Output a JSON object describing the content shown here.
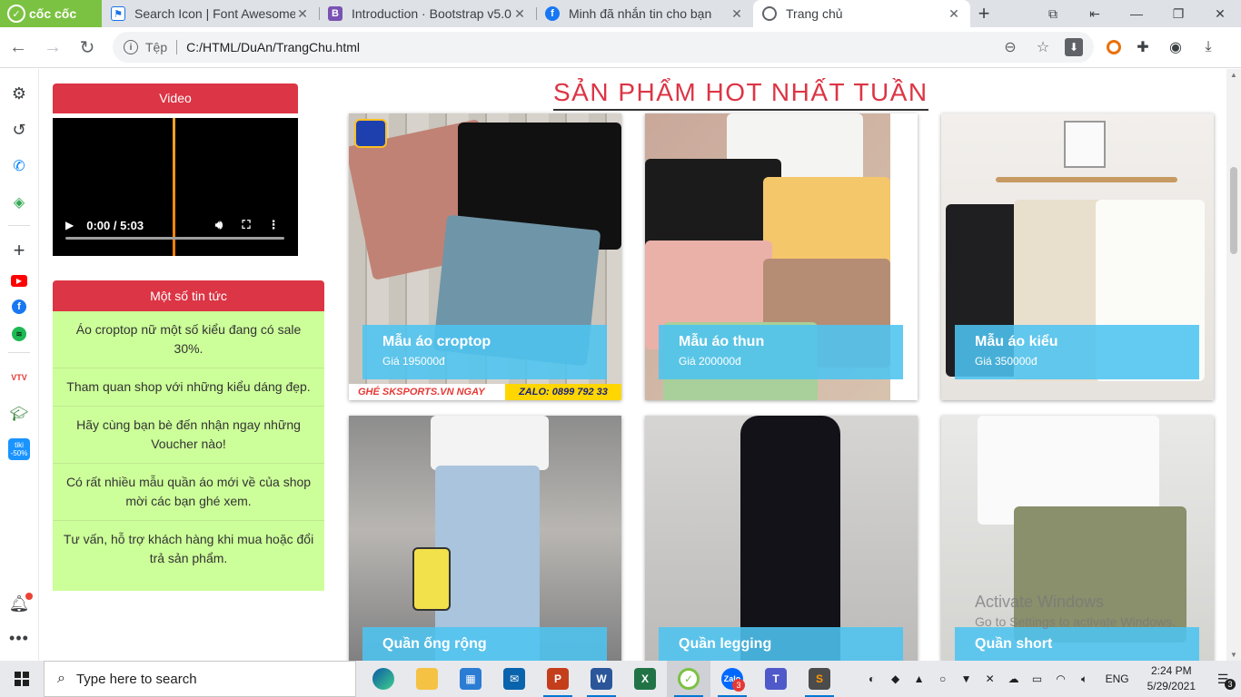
{
  "browser": {
    "logo_text": "cốc cốc",
    "tabs": [
      {
        "title": "Search Icon | Font Awesome",
        "favicon": "flag-icon",
        "active": false
      },
      {
        "title": "Introduction · Bootstrap v5.0",
        "favicon": "bootstrap-icon",
        "active": false
      },
      {
        "title": "Minh đã nhắn tin cho bạn",
        "favicon": "facebook-icon",
        "active": false
      },
      {
        "title": "Trang chủ",
        "favicon": "globe-icon",
        "active": true
      }
    ],
    "address": {
      "scheme_label": "Tệp",
      "url": "C:/HTML/DuAn/TrangChu.html"
    }
  },
  "page": {
    "video_header": "Video",
    "video_time": "0:00 / 5:03",
    "news_header": "Một số tin tức",
    "news": [
      "Áo croptop nữ một số kiểu đang có sale 30%.",
      "Tham quan shop với những kiểu dáng đẹp.",
      "Hãy cùng bạn bè đến nhận ngay những Voucher nào!",
      "Có rất nhiều mẫu quần áo mới về của shop mời các bạn ghé xem.",
      "Tư vấn, hỗ trợ khách hàng khi mua hoặc đổi trả sản phẩm."
    ],
    "section_title": "SẢN PHẨM HOT NHẤT TUẦN",
    "products": [
      {
        "name": "Mẫu áo croptop",
        "price": "Giá 195000đ"
      },
      {
        "name": "Mẫu áo thun",
        "price": "Giá 200000đ"
      },
      {
        "name": "Mẫu áo kiểu",
        "price": "Giá 350000đ"
      },
      {
        "name": "Quần ống rộng",
        "price": ""
      },
      {
        "name": "Quần legging",
        "price": ""
      },
      {
        "name": "Quần short",
        "price": ""
      }
    ],
    "photo_banner": {
      "left": "GHÉ SKSPORTS.VN NGAY",
      "right": "ZALO: 0899 792 33"
    },
    "watermark": {
      "line1": "Activate Windows",
      "line2": "Go to Settings to activate Windows."
    }
  },
  "taskbar": {
    "search_placeholder": "Type here to search",
    "zalo_badge": "3",
    "lang": "ENG",
    "time": "2:24 PM",
    "date": "5/29/2021",
    "notification_count": "3"
  },
  "colors": {
    "accent_red": "#dc3545",
    "news_bg": "#ccff99",
    "caption_blue": "#4dc4f0",
    "coccoc_green": "#7cc242"
  }
}
